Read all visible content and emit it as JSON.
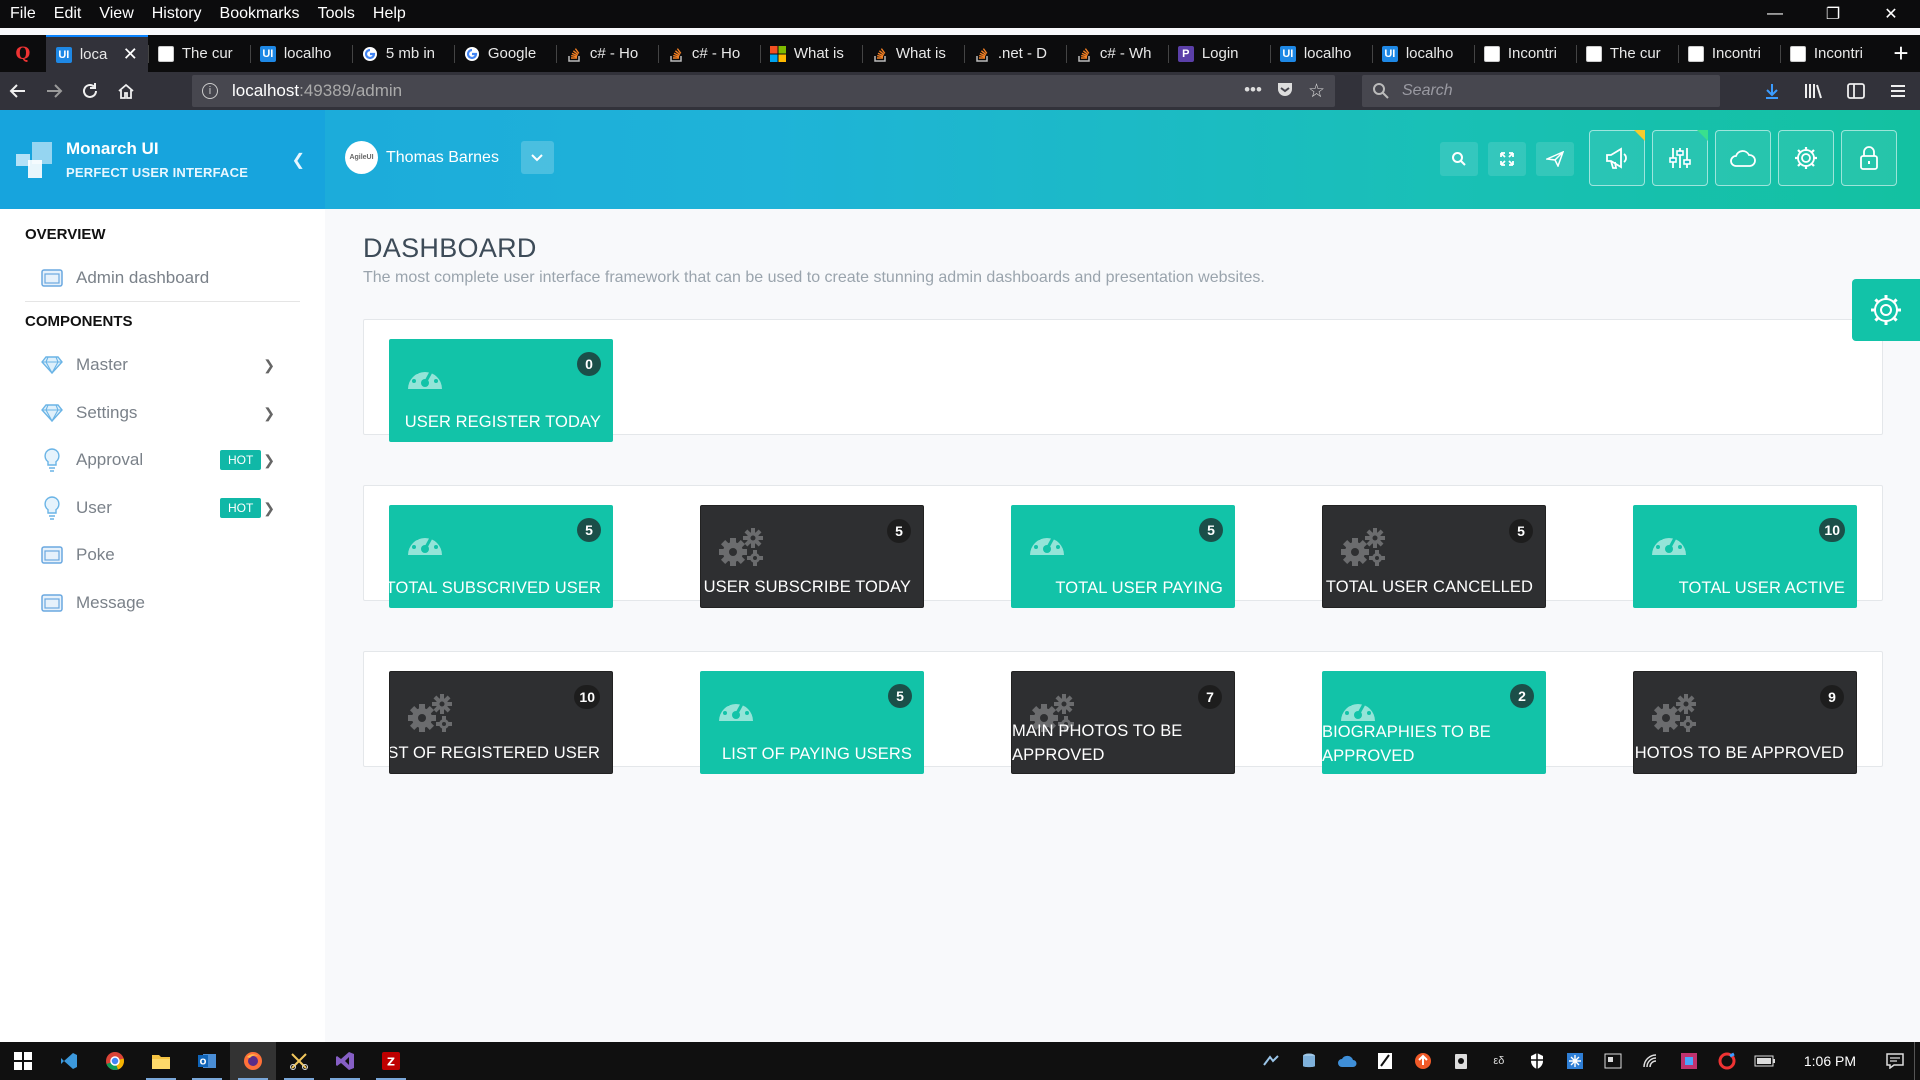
{
  "browser": {
    "menu": [
      "File",
      "Edit",
      "View",
      "History",
      "Bookmarks",
      "Tools",
      "Help"
    ],
    "tabs": [
      {
        "label": "loca",
        "favicon": "UI",
        "color": "#1e88e5",
        "active": true
      },
      {
        "label": "The cur",
        "favicon": "doc",
        "color": "#ffffff"
      },
      {
        "label": "localho",
        "favicon": "UI",
        "color": "#1e88e5"
      },
      {
        "label": "5 mb in",
        "favicon": "G",
        "color": "#ffffff"
      },
      {
        "label": "Google",
        "favicon": "G",
        "color": "#ffffff"
      },
      {
        "label": "c# - Ho",
        "favicon": "so",
        "color": "#f48024"
      },
      {
        "label": "c# - Ho",
        "favicon": "so",
        "color": "#f48024"
      },
      {
        "label": "What is",
        "favicon": "ms",
        "color": "#f25022"
      },
      {
        "label": "What is",
        "favicon": "so",
        "color": "#f48024"
      },
      {
        "label": ".net - D",
        "favicon": "so",
        "color": "#f48024"
      },
      {
        "label": "c# - Wh",
        "favicon": "so",
        "color": "#f48024"
      },
      {
        "label": "Login",
        "favicon": "P",
        "color": "#5b3fa8"
      },
      {
        "label": "localho",
        "favicon": "UI",
        "color": "#1e88e5"
      },
      {
        "label": "localho",
        "favicon": "UI",
        "color": "#1e88e5"
      },
      {
        "label": "Incontri",
        "favicon": "doc",
        "color": "#ffffff"
      },
      {
        "label": "The cur",
        "favicon": "doc",
        "color": "#ffffff"
      },
      {
        "label": "Incontri",
        "favicon": "doc",
        "color": "#ffffff"
      },
      {
        "label": "Incontri",
        "favicon": "doc",
        "color": "#ffffff"
      }
    ],
    "url_host": "localhost",
    "url_rest": ":49389/admin",
    "search_placeholder": "Search"
  },
  "app": {
    "brand_title": "Monarch UI",
    "brand_subtitle": "PERFECT USER INTERFACE",
    "user_name": "Thomas Barnes",
    "avatar_text": "AgileUI",
    "accent": "#12c3a8",
    "header_gradient": [
      "#1aa6dc",
      "#13c1a1"
    ]
  },
  "sidebar": {
    "overview_title": "OVERVIEW",
    "components_title": "COMPONENTS",
    "items": [
      {
        "label": "Admin dashboard",
        "icon": "dashboard-icon"
      },
      {
        "label": "Master",
        "icon": "diamond-icon",
        "chevron": true
      },
      {
        "label": "Settings",
        "icon": "diamond-icon",
        "chevron": true
      },
      {
        "label": "Approval",
        "icon": "lightbulb-icon",
        "badge": "HOT",
        "chevron": true
      },
      {
        "label": "User",
        "icon": "lightbulb-icon",
        "badge": "HOT",
        "chevron": true
      },
      {
        "label": "Poke",
        "icon": "browser-window-icon"
      },
      {
        "label": "Message",
        "icon": "browser-window-icon"
      }
    ]
  },
  "dashboard": {
    "title": "DASHBOARD",
    "subtitle": "The most complete user interface framework that can be used to create stunning admin dashboards and presentation websites.",
    "panel1": [
      {
        "label": "USER REGISTER TODAY",
        "count": "0",
        "style": "teal",
        "icon": "speedometer-icon"
      }
    ],
    "panel2": [
      {
        "label": "TOTAL SUBSCRIVED USER",
        "count": "5",
        "style": "teal",
        "icon": "speedometer-icon"
      },
      {
        "label": "USER SUBSCRIBE TODAY",
        "count": "5",
        "style": "dark",
        "icon": "gears-icon"
      },
      {
        "label": "TOTAL USER PAYING",
        "count": "5",
        "style": "teal",
        "icon": "speedometer-icon"
      },
      {
        "label": "TOTAL USER CANCELLED",
        "count": "5",
        "style": "dark",
        "icon": "gears-icon"
      },
      {
        "label": "TOTAL USER ACTIVE",
        "count": "10",
        "style": "teal",
        "icon": "speedometer-icon"
      }
    ],
    "panel3": [
      {
        "label": "LIST OF REGISTERED USER",
        "count": "10",
        "style": "dark",
        "icon": "gears-icon"
      },
      {
        "label": "LIST OF PAYING USERS",
        "count": "5",
        "style": "teal",
        "icon": "speedometer-icon"
      },
      {
        "label": "MAIN PHOTOS TO BE APPROVED",
        "count": "7",
        "style": "dark",
        "icon": "gears-icon",
        "wrap": true
      },
      {
        "label": "BIOGRAPHIES TO BE APPROVED",
        "count": "2",
        "style": "teal",
        "icon": "speedometer-icon",
        "wrap": true
      },
      {
        "label": "PHOTOS TO BE APPROVED",
        "count": "9",
        "style": "dark",
        "icon": "gears-icon"
      }
    ]
  },
  "taskbar": {
    "clock": "1:06 PM"
  }
}
